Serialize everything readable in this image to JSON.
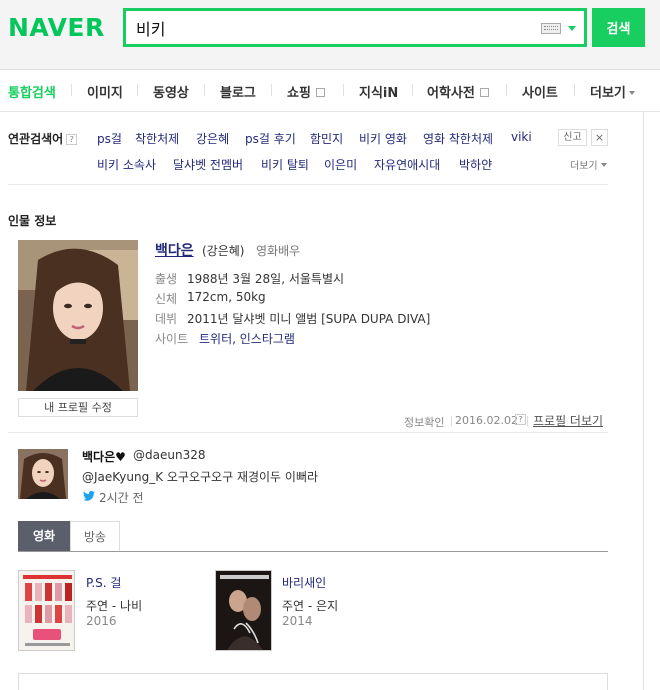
{
  "header": {
    "logo": "NAVER",
    "search_value": "비키",
    "search_button": "검색",
    "brand_color": "#19ce60"
  },
  "tabs": [
    {
      "label": "통합검색",
      "active": true
    },
    {
      "label": "이미지"
    },
    {
      "label": "동영상"
    },
    {
      "label": "블로그"
    },
    {
      "label": "쇼핑"
    },
    {
      "label": "지식iN"
    },
    {
      "label": "어학사전"
    },
    {
      "label": "사이트"
    },
    {
      "label": "더보기"
    }
  ],
  "related": {
    "label": "연관검색어",
    "help": "?",
    "row1": [
      "ps걸",
      "착한처제",
      "강은혜",
      "ps걸 후기",
      "함민지",
      "비키 영화",
      "영화 착한처제",
      "viki"
    ],
    "row2": [
      "비키 소속사",
      "달샤벳 전멤버",
      "비키 탈퇴",
      "이은미",
      "자유연애시대",
      "박하얀"
    ],
    "report": "신고",
    "close": "×",
    "more": "더보기"
  },
  "person": {
    "section_title": "인물 정보",
    "name": "백다은",
    "alias": "(강은혜)",
    "job": "영화배우",
    "edit_profile": "내 프로필 수정",
    "info": [
      {
        "key": "출생",
        "value": "1988년 3월 28일, 서울특별시"
      },
      {
        "key": "신체",
        "value": "172cm, 50kg"
      },
      {
        "key": "데뷔",
        "value": "2011년 달샤벳 미니 앨범 [SUPA DUPA DIVA]"
      },
      {
        "key": "사이트",
        "value": "트위터, 인스타그램"
      }
    ],
    "check_label": "정보확인",
    "check_date": "2016.02.02",
    "help": "?",
    "more_profile": "프로필 더보기"
  },
  "tweet": {
    "name": "백다은♥",
    "handle": "@daeun328",
    "text": "@JaeKyung_K 오구오구오구 재경이두 이뻐라",
    "time": "2시간 전"
  },
  "film_tabs": [
    "영화",
    "방송"
  ],
  "movies": [
    {
      "title": "P.S. 걸",
      "role": "주연 - 나비",
      "year": "2016"
    },
    {
      "title": "바리새인",
      "role": "주연 - 은지",
      "year": "2014"
    }
  ]
}
